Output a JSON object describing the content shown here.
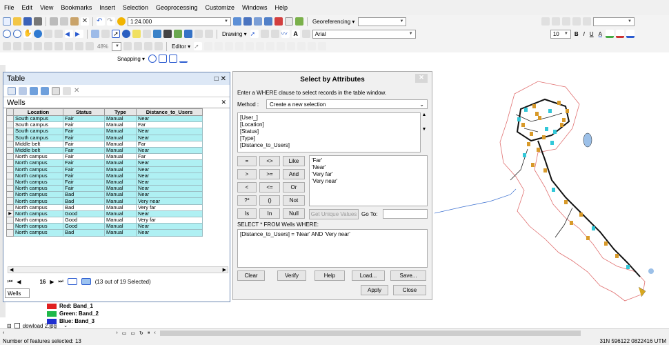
{
  "menu": [
    "File",
    "Edit",
    "View",
    "Bookmarks",
    "Insert",
    "Selection",
    "Geoprocessing",
    "Customize",
    "Windows",
    "Help"
  ],
  "toolbar": {
    "scale": "1:24.000",
    "georeferencing": "Georeferencing ▾",
    "drawing": "Drawing ▾",
    "font": "Arial",
    "font_size": "10",
    "bold": "B",
    "italic": "I",
    "underline": "U",
    "font_color": "A",
    "zoom": "48%",
    "editor": "Editor ▾",
    "snapping": "Snapping ▾"
  },
  "table_window": {
    "title": "Table",
    "layer": "Wells",
    "columns": [
      "Location",
      "Status",
      "Type",
      "Distance_to_Users"
    ],
    "rows": [
      {
        "location": "South campus",
        "status": "Fair",
        "type": "Manual",
        "distance": "Near",
        "selected": true
      },
      {
        "location": "South campus",
        "status": "Fair",
        "type": "Manual",
        "distance": "Far",
        "selected": false
      },
      {
        "location": "South campus",
        "status": "Fair",
        "type": "Manual",
        "distance": "Near",
        "selected": true
      },
      {
        "location": "South campus",
        "status": "Fair",
        "type": "Manual",
        "distance": "Near",
        "selected": true
      },
      {
        "location": "Middle belt",
        "status": "Fair",
        "type": "Manual",
        "distance": "Far",
        "selected": false
      },
      {
        "location": "Middle belt",
        "status": "Fair",
        "type": "Manual",
        "distance": "Near",
        "selected": true
      },
      {
        "location": "North campus",
        "status": "Fair",
        "type": "Manual",
        "distance": "Far",
        "selected": false
      },
      {
        "location": "North campus",
        "status": "Fair",
        "type": "Manual",
        "distance": "Near",
        "selected": true
      },
      {
        "location": "North campus",
        "status": "Fair",
        "type": "Manual",
        "distance": "Near",
        "selected": true
      },
      {
        "location": "North campus",
        "status": "Fair",
        "type": "Manual",
        "distance": "Near",
        "selected": true
      },
      {
        "location": "North campus",
        "status": "Fair",
        "type": "Manual",
        "distance": "Near",
        "selected": true
      },
      {
        "location": "North campus",
        "status": "Fair",
        "type": "Manual",
        "distance": "Near",
        "selected": true
      },
      {
        "location": "North campus",
        "status": "Bad",
        "type": "Manual",
        "distance": "Near",
        "selected": true
      },
      {
        "location": "North campus",
        "status": "Bad",
        "type": "Manual",
        "distance": "Very near",
        "selected": true
      },
      {
        "location": "North campus",
        "status": "Bad",
        "type": "Manual",
        "distance": "Very far",
        "selected": false
      },
      {
        "location": "North campus",
        "status": "Good",
        "type": "Manual",
        "distance": "Near",
        "selected": true,
        "current": true
      },
      {
        "location": "North campus",
        "status": "Good",
        "type": "Manual",
        "distance": "Very far",
        "selected": false
      },
      {
        "location": "North campus",
        "status": "Good",
        "type": "Manual",
        "distance": "Near",
        "selected": true
      },
      {
        "location": "North campus",
        "status": "Bad",
        "type": "Manual",
        "distance": "Near",
        "selected": true
      }
    ],
    "record": "16",
    "selection_status": "(13 out of 19 Selected)",
    "tab": "Wells"
  },
  "toc": {
    "red": "Red: Band_1",
    "green": "Green: Band_2",
    "blue": "Blue: Band_3",
    "layer2": "dowload 2.jpg",
    "colors": {
      "red": "#e02020",
      "green": "#1fb84a",
      "blue": "#2030d0"
    }
  },
  "dialog": {
    "title": "Select by Attributes",
    "instruction": "Enter a WHERE clause to select records in the table window.",
    "method_label": "Method :",
    "method_value": "Create a new selection",
    "fields": [
      "[User_]",
      "[Location]",
      "[Status]",
      "[Type]",
      "[Distance_to_Users]"
    ],
    "operators": [
      "=",
      "<>",
      "Like",
      ">",
      ">=",
      "And",
      "<",
      "<=",
      "Or",
      "?*",
      "()",
      "Not",
      "Is",
      "In",
      "Null"
    ],
    "values": [
      "'Far'",
      "'Near'",
      "'Very far'",
      "'Very near'"
    ],
    "get_unique": "Get Unique Values",
    "goto_label": "Go To:",
    "select_from": "SELECT * FROM Wells WHERE:",
    "expression": "[Distance_to_Users] = 'Near' AND 'Very near'",
    "buttons": {
      "clear": "Clear",
      "verify": "Verify",
      "help": "Help",
      "load": "Load...",
      "save": "Save...",
      "apply": "Apply",
      "close": "Close"
    }
  },
  "status": {
    "left": "Number of features selected: 13",
    "right": "31N 596122 0822416 UTM"
  }
}
